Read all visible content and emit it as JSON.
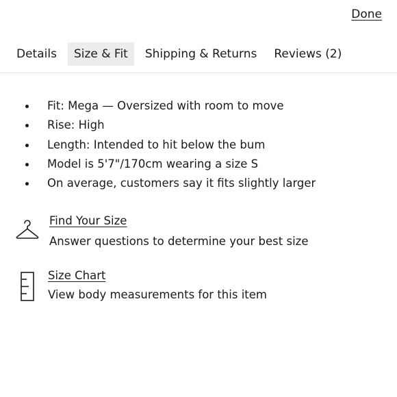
{
  "header": {
    "done_label": "Done"
  },
  "tabs": [
    {
      "label": "Details",
      "active": false
    },
    {
      "label": "Size & Fit",
      "active": true
    },
    {
      "label": "Shipping & Returns",
      "active": false
    },
    {
      "label": "Reviews (2)",
      "active": false
    }
  ],
  "fit_details": [
    "Fit: Mega — Oversized with room to move",
    "Rise: High",
    "Length: Intended to hit below the bum",
    "Model is 5'7\"/170cm wearing a size S",
    "On average, customers say it fits slightly larger"
  ],
  "tools": {
    "find_size": {
      "icon": "hanger-icon",
      "title": "Find Your Size",
      "description": "Answer questions to determine your best size"
    },
    "size_chart": {
      "icon": "ruler-icon",
      "title": "Size Chart",
      "description": "View body measurements for this item"
    }
  },
  "colors": {
    "active_tab_bg": "#ececec",
    "text": "#1a1a1a",
    "divider": "#e3e3e3"
  }
}
